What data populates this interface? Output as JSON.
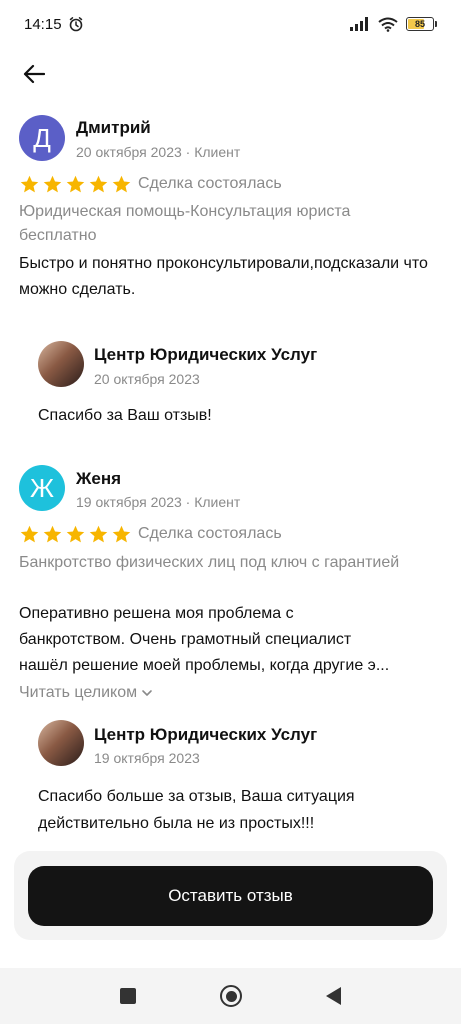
{
  "status_bar": {
    "time": "14:15",
    "battery": "85"
  },
  "reviews": [
    {
      "avatar_letter": "Д",
      "avatar_color": "#5b5fc7",
      "author": "Дмитрий",
      "meta": "20 октября 2023 · Клиент",
      "rating": 5,
      "deal_status": "Сделка состоялась",
      "service": "Юридическая помощь-Консультация юриста бесплатно",
      "text": "Быстро и понятно проконсультировали,подсказали что можно сделать.",
      "reply": {
        "company": "Центр Юридических Услуг",
        "date": "20 октября 2023",
        "text": "Спасибо за Ваш отзыв!"
      }
    },
    {
      "avatar_letter": "Ж",
      "avatar_color": "#1ec1dc",
      "author": "Женя",
      "meta": "19 октября 2023 · Клиент",
      "rating": 5,
      "deal_status": "Сделка состоялась",
      "service": "Банкротство физических лиц под ключ с гарантией",
      "text_line1": "Оперативно решена моя проблема с",
      "text_line2": "банкротством. Очень грамотный специалист",
      "text_line3": "нашёл  решение моей проблемы, когда другие э...",
      "read_more": "Читать целиком",
      "reply": {
        "company": "Центр Юридических Услуг",
        "date": "19 октября 2023",
        "text": "Спасибо больше за отзыв, Ваша ситуация действительно была не из простых!!!"
      }
    }
  ],
  "colors": {
    "star": "#f7b500",
    "button_bg": "#141414"
  },
  "actions": {
    "leave_review": "Оставить отзыв"
  }
}
